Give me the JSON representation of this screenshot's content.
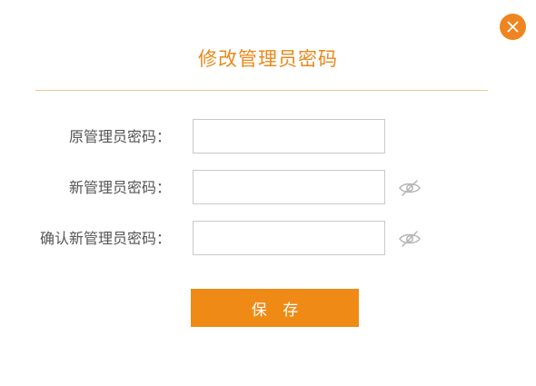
{
  "dialog": {
    "title": "修改管理员密码",
    "close_icon": "close-x-icon",
    "accent_color": "#ef8520"
  },
  "fields": [
    {
      "label": "原管理员密码：",
      "value": "",
      "placeholder": ""
    },
    {
      "label": "新管理员密码：",
      "value": "",
      "placeholder": "",
      "icon": "eye-slash-icon"
    },
    {
      "label": "确认新管理员密码：",
      "value": "",
      "placeholder": "",
      "icon": "eye-slash-icon"
    }
  ],
  "save_button": {
    "label": "保 存",
    "color": "#f08a16"
  }
}
